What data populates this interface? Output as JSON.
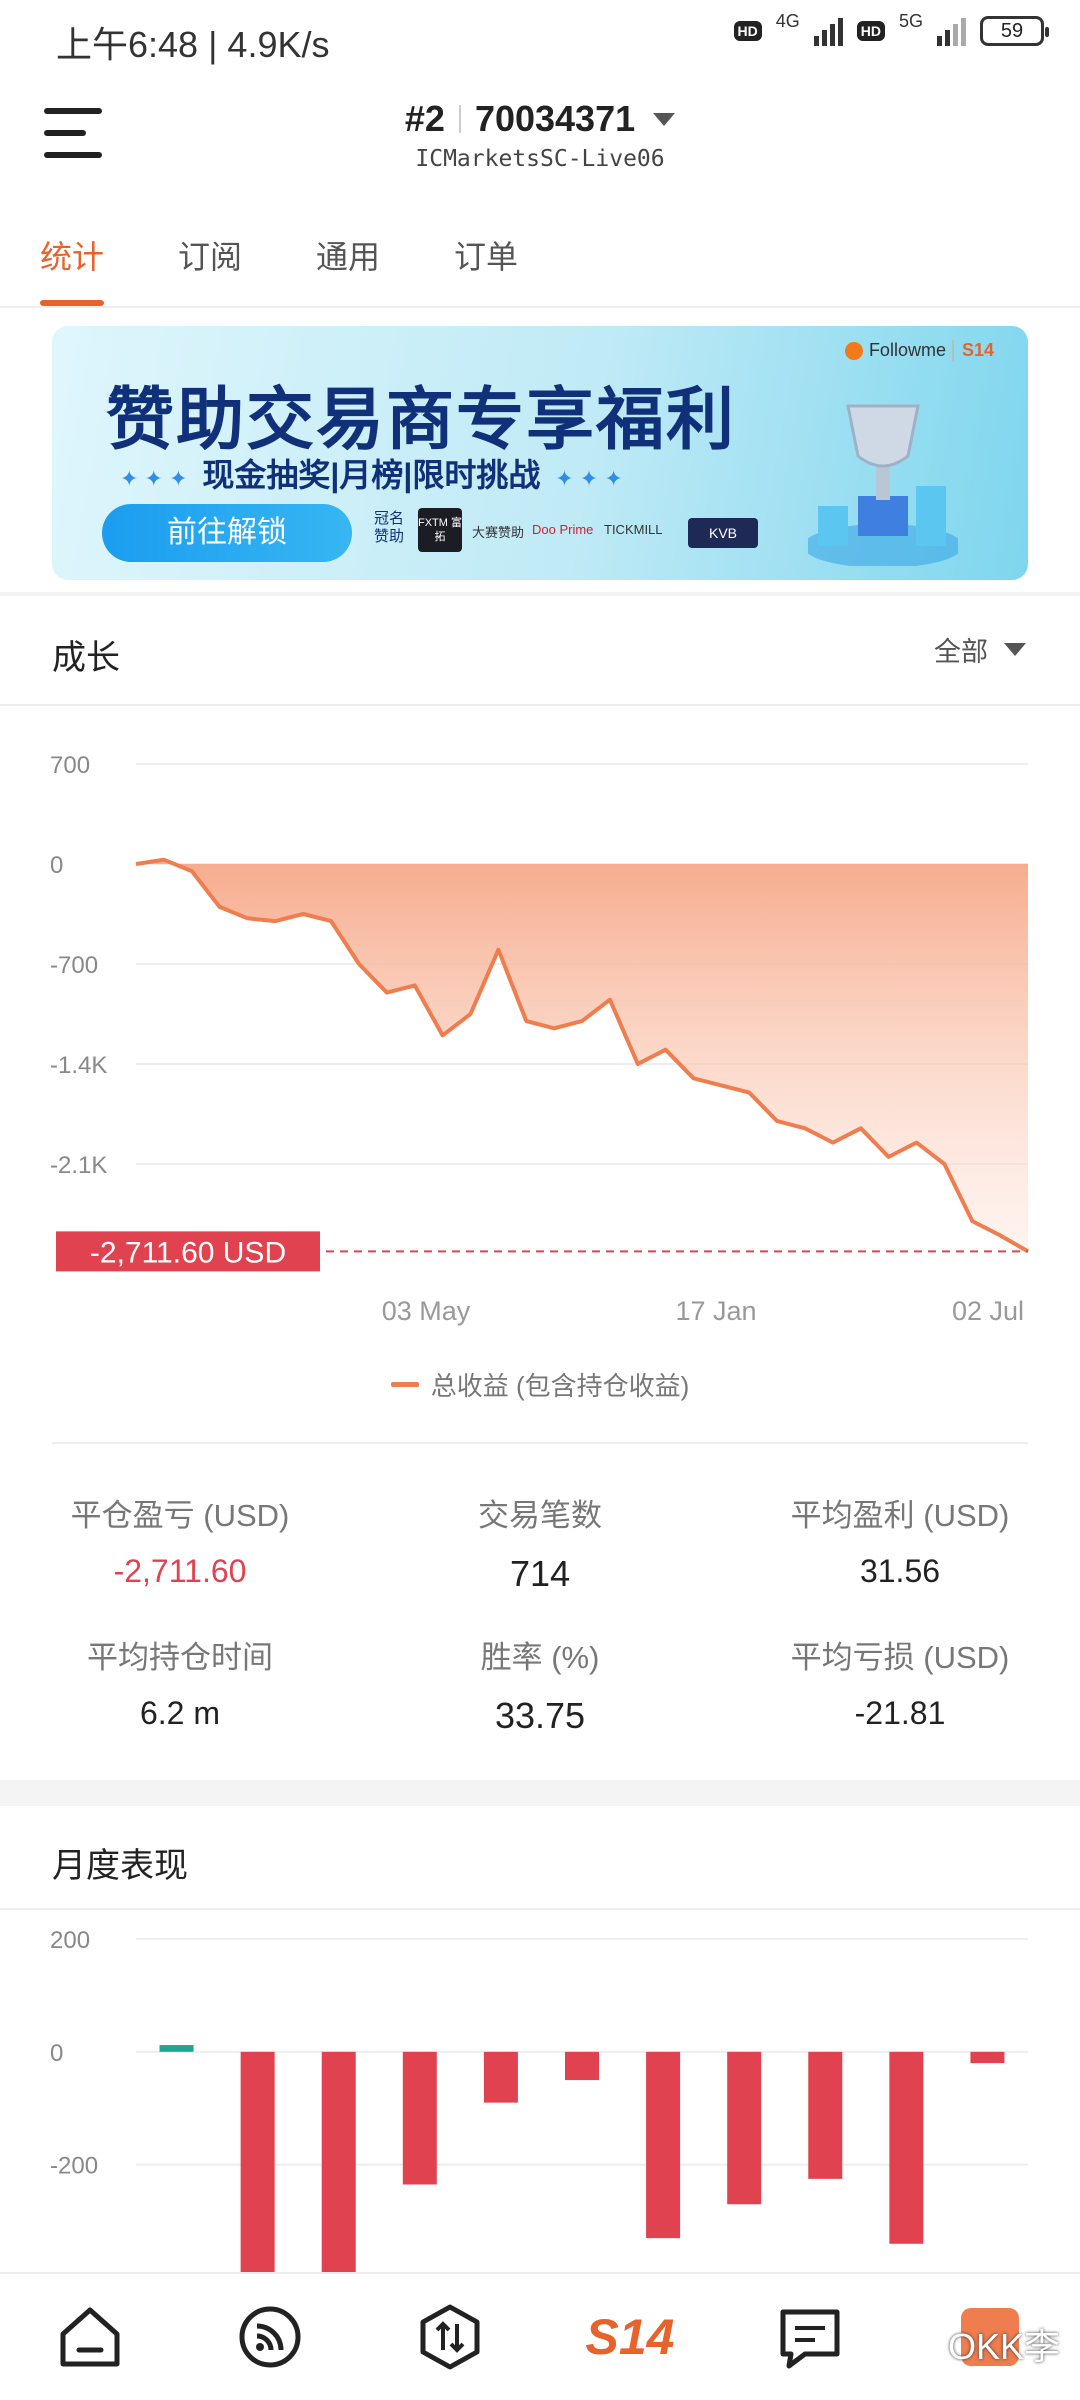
{
  "status_bar": {
    "time": "上午6:48 | 4.9K/s",
    "hd1": "HD",
    "net1": "4G",
    "hd2": "HD",
    "net2": "5G",
    "battery": "59"
  },
  "header": {
    "rank": "#2",
    "account": "70034371",
    "server": "ICMarketsSC-Live06"
  },
  "tabs": [
    {
      "label": "统计",
      "active": true
    },
    {
      "label": "订阅",
      "active": false
    },
    {
      "label": "通用",
      "active": false
    },
    {
      "label": "订单",
      "active": false
    }
  ],
  "banner": {
    "brand": "Followme",
    "brand_badge": "S14",
    "title": "赞助交易商专享福利",
    "subtitle": "现金抽奖|月榜|限时挑战",
    "cta": "前往解锁",
    "sponsor_label": "冠名赞助",
    "sponsor_logo": "FXTM 富拓",
    "sponsor_text": "大赛赞助",
    "logos": [
      "Doo Prime",
      "TICKMILL",
      "KVB"
    ]
  },
  "growth": {
    "title": "成长",
    "range": "全部",
    "legend": "总收益 (包含持仓收益)",
    "current_label": "-2,711.60 USD"
  },
  "stats": {
    "closed_pnl_label": "平仓盈亏 (USD)",
    "closed_pnl": "-2,711.60",
    "trades_label": "交易笔数",
    "trades": "714",
    "avg_profit_label": "平均盈利 (USD)",
    "avg_profit": "31.56",
    "avg_hold_label": "平均持仓时间",
    "avg_hold": "6.2 m",
    "win_rate_label": "胜率 (%)",
    "win_rate": "33.75",
    "avg_loss_label": "平均亏损 (USD)",
    "avg_loss": "-21.81"
  },
  "monthly": {
    "title": "月度表现"
  },
  "nav": {
    "items": [
      "home-icon",
      "feed-icon",
      "trade-icon",
      "S14",
      "message-icon",
      "profile-icon"
    ],
    "s14_label": "S14",
    "watermark": "OKK李"
  },
  "colors": {
    "accent": "#e8632b",
    "negative": "#e0434f",
    "positive": "#1fa596",
    "area_line": "#ef7d4e"
  },
  "chart_data": [
    {
      "type": "area",
      "title": "成长",
      "yticks": [
        "700",
        "0",
        "-700",
        "-1.4K",
        "-2.1K"
      ],
      "ylim": [
        -2800,
        700
      ],
      "xticks": [
        "03 May",
        "17 Jan",
        "02 Jul"
      ],
      "series": [
        {
          "name": "总收益 (包含持仓收益)",
          "values": [
            0,
            30,
            -50,
            -300,
            -380,
            -400,
            -350,
            -400,
            -700,
            -900,
            -850,
            -1200,
            -1050,
            -600,
            -1100,
            -1150,
            -1100,
            -950,
            -1400,
            -1300,
            -1500,
            -1550,
            -1600,
            -1800,
            -1850,
            -1950,
            -1850,
            -2050,
            -1950,
            -2100,
            -2500,
            -2600,
            -2711.6
          ]
        }
      ],
      "current_value_label": "-2,711.60 USD"
    },
    {
      "type": "bar",
      "title": "月度表现",
      "yticks": [
        "200",
        "0",
        "-200"
      ],
      "ylim": [
        -390,
        230
      ],
      "values": [
        12,
        -390,
        -390,
        -235,
        -90,
        -50,
        -330,
        -270,
        -225,
        -340,
        -20
      ]
    }
  ]
}
